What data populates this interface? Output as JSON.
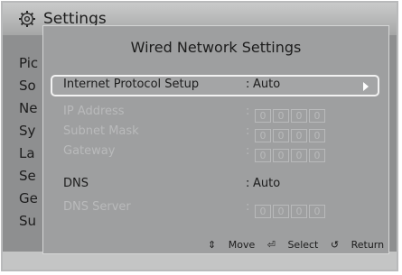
{
  "header": {
    "title": "Settings",
    "icon": "gear-icon"
  },
  "menu": [
    {
      "label": "Pic"
    },
    {
      "label": "So"
    },
    {
      "label": "Ne"
    },
    {
      "label": "Sy"
    },
    {
      "label": "La"
    },
    {
      "label": "Se"
    },
    {
      "label": "Ge"
    },
    {
      "label": "Su"
    }
  ],
  "dialog": {
    "title": "Wired Network Settings",
    "rows": [
      {
        "label": "Internet Protocol Setup",
        "colon": ":",
        "value": "Auto",
        "selected": true,
        "enabled": true
      },
      {
        "label": "IP Address",
        "colon": ":",
        "octets": [
          "0",
          "0",
          "0",
          "0"
        ],
        "enabled": false
      },
      {
        "label": "Subnet Mask",
        "colon": ":",
        "octets": [
          "0",
          "0",
          "0",
          "0"
        ],
        "enabled": false
      },
      {
        "label": "Gateway",
        "colon": ":",
        "octets": [
          "0",
          "0",
          "0",
          "0"
        ],
        "enabled": false
      },
      {
        "label": "DNS",
        "colon": ":",
        "value": "Auto",
        "enabled": true
      },
      {
        "label": "DNS Server",
        "colon": ":",
        "octets": [
          "0",
          "0",
          "0",
          "0"
        ],
        "enabled": false
      }
    ],
    "footer": {
      "move": "Move",
      "select": "Select",
      "return": "Return"
    }
  },
  "colors": {
    "selection_border": "#f2f2f2",
    "disabled_text": "#b9babb"
  }
}
